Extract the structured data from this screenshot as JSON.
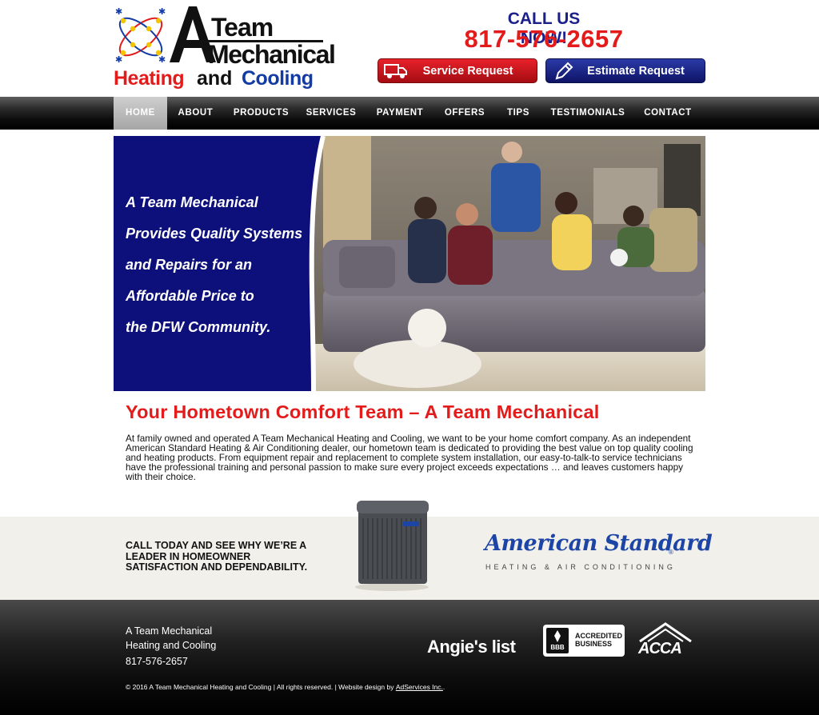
{
  "header": {
    "logo": {
      "line1": "Team",
      "line2": "Mechanical",
      "word_heating": "Heating",
      "word_and": "and",
      "word_cooling": "Cooling",
      "letter": "A"
    },
    "call_label": "CALL US NOW!",
    "phone": "817-576-2657",
    "service_button": "Service Request",
    "estimate_button": "Estimate Request"
  },
  "nav": {
    "items": [
      {
        "label": "HOME",
        "active": true
      },
      {
        "label": "ABOUT"
      },
      {
        "label": "PRODUCTS"
      },
      {
        "label": "SERVICES"
      },
      {
        "label": "PAYMENT"
      },
      {
        "label": "OFFERS"
      },
      {
        "label": "TIPS"
      },
      {
        "label": "TESTIMONIALS"
      },
      {
        "label": "CONTACT"
      }
    ]
  },
  "hero": {
    "lines": [
      "A Team Mechanical",
      "Provides Quality Systems",
      "and Repairs for an",
      "Affordable Price to",
      "the DFW Community."
    ]
  },
  "main": {
    "headline": "Your Hometown Comfort Team – A Team Mechanical",
    "intro": "At family owned and operated A Team Mechanical Heating and Cooling, we want to be your home comfort company. As an independent American Standard Heating & Air Conditioning dealer, our hometown team is dedicated to providing the best value on top quality cooling and heating products. From equipment repair and replacement to complete system installation, our easy-to-talk-to service technicians have the professional training and personal passion to make sure every project exceeds expectations … and leaves customers happy with their choice."
  },
  "promo": {
    "lines": [
      "CALL TODAY AND SEE WHY WE’RE A",
      "LEADER IN HOMEOWNER",
      "SATISFACTION AND DEPENDABILITY."
    ],
    "brand": "American Standard",
    "brand_reg": "®",
    "brand_sub": "HEATING & AIR CONDITIONING"
  },
  "footer": {
    "name_line1": "A Team Mechanical",
    "name_line2": "Heating and Cooling",
    "phone": "817-576-2657",
    "copyright": "© 2016 A Team Mechanical Heating and Cooling | All rights reserved. | Website design by",
    "designer": "AdServices Inc.",
    "copyright_end": ".",
    "badges": {
      "angies": "Angie's list",
      "bbb_line1": "ACCREDITED",
      "bbb_line2": "BUSINESS",
      "bbb_icon": "BBB",
      "acca": "ACCA"
    }
  },
  "colors": {
    "red": "#e31b1b",
    "navy": "#1a1f8c",
    "blue": "#123ba3",
    "hero_panel": "#0d0f7a"
  }
}
